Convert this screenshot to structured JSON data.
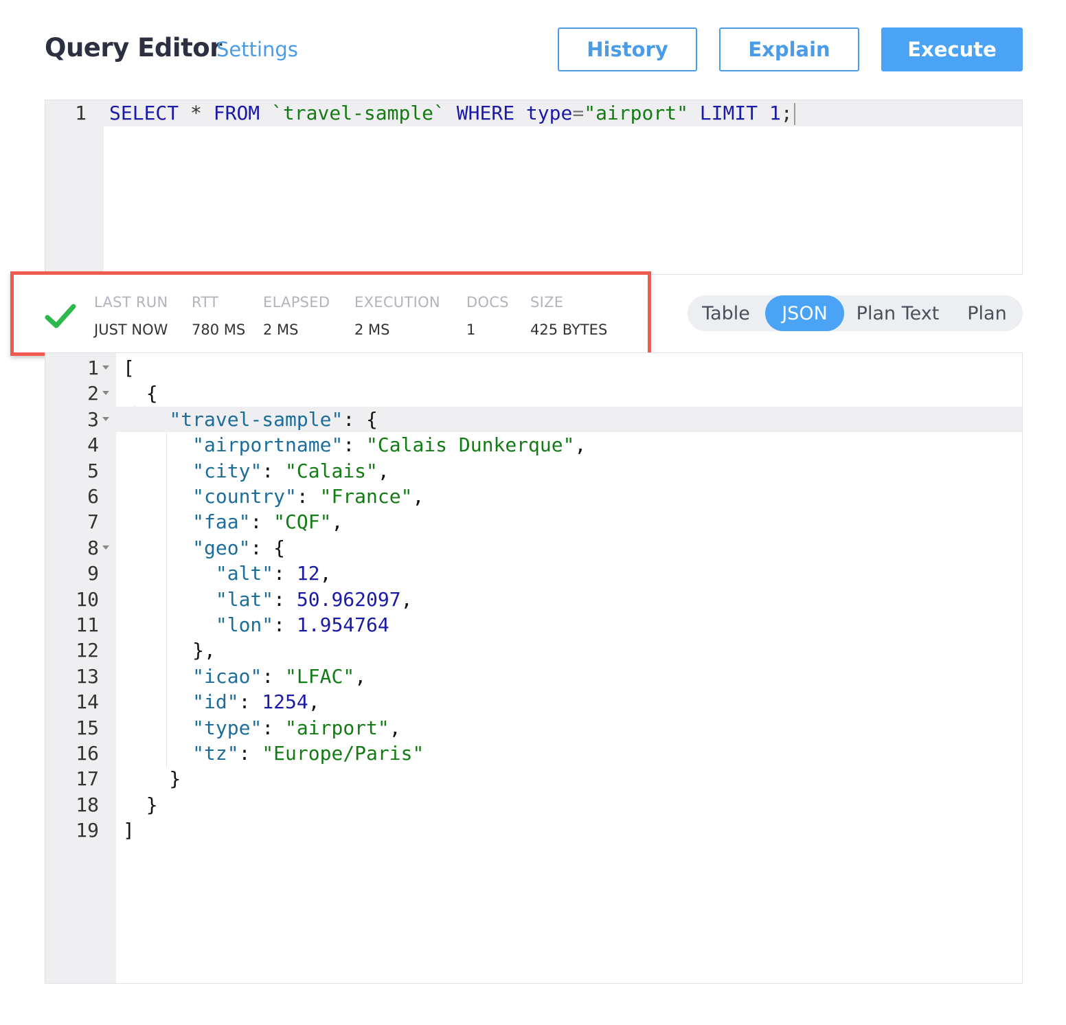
{
  "header": {
    "title": "Query Editor",
    "settings_label": "Settings",
    "buttons": {
      "history": "History",
      "explain": "Explain",
      "execute": "Execute"
    }
  },
  "query": {
    "line_number": "1",
    "tokens": {
      "select": "SELECT",
      "star": " * ",
      "from": "FROM",
      "sp1": " ",
      "bucket": "`travel-sample`",
      "sp2": " ",
      "where": "WHERE",
      "sp3": " ",
      "field": "type",
      "eq": "=",
      "value": "\"airport\"",
      "sp4": " ",
      "limit": "LIMIT",
      "sp5": " ",
      "limit_value": "1",
      "semi": ";"
    }
  },
  "status": {
    "items": [
      {
        "label": "LAST RUN",
        "value": "JUST NOW"
      },
      {
        "label": "RTT",
        "value": "780 MS"
      },
      {
        "label": "ELAPSED",
        "value": "2 MS"
      },
      {
        "label": "EXECUTION",
        "value": "2 MS"
      },
      {
        "label": "DOCS",
        "value": "1"
      },
      {
        "label": "SIZE",
        "value": "425 BYTES"
      }
    ],
    "success_color": "#2db84d"
  },
  "view_tabs": {
    "table": "Table",
    "json": "JSON",
    "plan_text": "Plan Text",
    "plan": "Plan",
    "active": "JSON"
  },
  "result": {
    "lines": [
      {
        "n": "1",
        "fold": true,
        "tokens": [
          {
            "t": "[",
            "c": "p"
          }
        ]
      },
      {
        "n": "2",
        "fold": true,
        "tokens": [
          {
            "t": "  {",
            "c": "p"
          }
        ]
      },
      {
        "n": "3",
        "fold": true,
        "active": true,
        "tokens": [
          {
            "t": "    ",
            "c": "p"
          },
          {
            "t": "\"travel-sample\"",
            "c": "k"
          },
          {
            "t": ": {",
            "c": "p"
          }
        ]
      },
      {
        "n": "4",
        "tokens": [
          {
            "t": "      ",
            "c": "p"
          },
          {
            "t": "\"airportname\"",
            "c": "k"
          },
          {
            "t": ": ",
            "c": "p"
          },
          {
            "t": "\"Calais Dunkerque\"",
            "c": "s"
          },
          {
            "t": ",",
            "c": "p"
          }
        ]
      },
      {
        "n": "5",
        "tokens": [
          {
            "t": "      ",
            "c": "p"
          },
          {
            "t": "\"city\"",
            "c": "k"
          },
          {
            "t": ": ",
            "c": "p"
          },
          {
            "t": "\"Calais\"",
            "c": "s"
          },
          {
            "t": ",",
            "c": "p"
          }
        ]
      },
      {
        "n": "6",
        "tokens": [
          {
            "t": "      ",
            "c": "p"
          },
          {
            "t": "\"country\"",
            "c": "k"
          },
          {
            "t": ": ",
            "c": "p"
          },
          {
            "t": "\"France\"",
            "c": "s"
          },
          {
            "t": ",",
            "c": "p"
          }
        ]
      },
      {
        "n": "7",
        "tokens": [
          {
            "t": "      ",
            "c": "p"
          },
          {
            "t": "\"faa\"",
            "c": "k"
          },
          {
            "t": ": ",
            "c": "p"
          },
          {
            "t": "\"CQF\"",
            "c": "s"
          },
          {
            "t": ",",
            "c": "p"
          }
        ]
      },
      {
        "n": "8",
        "fold": true,
        "tokens": [
          {
            "t": "      ",
            "c": "p"
          },
          {
            "t": "\"geo\"",
            "c": "k"
          },
          {
            "t": ": {",
            "c": "p"
          }
        ]
      },
      {
        "n": "9",
        "tokens": [
          {
            "t": "        ",
            "c": "p"
          },
          {
            "t": "\"alt\"",
            "c": "k"
          },
          {
            "t": ": ",
            "c": "p"
          },
          {
            "t": "12",
            "c": "n"
          },
          {
            "t": ",",
            "c": "p"
          }
        ]
      },
      {
        "n": "10",
        "tokens": [
          {
            "t": "        ",
            "c": "p"
          },
          {
            "t": "\"lat\"",
            "c": "k"
          },
          {
            "t": ": ",
            "c": "p"
          },
          {
            "t": "50.962097",
            "c": "n"
          },
          {
            "t": ",",
            "c": "p"
          }
        ]
      },
      {
        "n": "11",
        "tokens": [
          {
            "t": "        ",
            "c": "p"
          },
          {
            "t": "\"lon\"",
            "c": "k"
          },
          {
            "t": ": ",
            "c": "p"
          },
          {
            "t": "1.954764",
            "c": "n"
          }
        ]
      },
      {
        "n": "12",
        "tokens": [
          {
            "t": "      },",
            "c": "p"
          }
        ]
      },
      {
        "n": "13",
        "tokens": [
          {
            "t": "      ",
            "c": "p"
          },
          {
            "t": "\"icao\"",
            "c": "k"
          },
          {
            "t": ": ",
            "c": "p"
          },
          {
            "t": "\"LFAC\"",
            "c": "s"
          },
          {
            "t": ",",
            "c": "p"
          }
        ]
      },
      {
        "n": "14",
        "tokens": [
          {
            "t": "      ",
            "c": "p"
          },
          {
            "t": "\"id\"",
            "c": "k"
          },
          {
            "t": ": ",
            "c": "p"
          },
          {
            "t": "1254",
            "c": "n"
          },
          {
            "t": ",",
            "c": "p"
          }
        ]
      },
      {
        "n": "15",
        "tokens": [
          {
            "t": "      ",
            "c": "p"
          },
          {
            "t": "\"type\"",
            "c": "k"
          },
          {
            "t": ": ",
            "c": "p"
          },
          {
            "t": "\"airport\"",
            "c": "s"
          },
          {
            "t": ",",
            "c": "p"
          }
        ]
      },
      {
        "n": "16",
        "tokens": [
          {
            "t": "      ",
            "c": "p"
          },
          {
            "t": "\"tz\"",
            "c": "k"
          },
          {
            "t": ": ",
            "c": "p"
          },
          {
            "t": "\"Europe/Paris\"",
            "c": "s"
          }
        ]
      },
      {
        "n": "17",
        "tokens": [
          {
            "t": "    }",
            "c": "p"
          }
        ]
      },
      {
        "n": "18",
        "tokens": [
          {
            "t": "  }",
            "c": "p"
          }
        ]
      },
      {
        "n": "19",
        "tokens": [
          {
            "t": "]",
            "c": "p"
          }
        ]
      }
    ]
  },
  "colors": {
    "accent": "#4aa3f5",
    "highlight_border": "#f05a4f",
    "key": "#1d6d9a",
    "string": "#137b13",
    "number": "#1a1aa6",
    "keyword": "#1a1aa6"
  },
  "icons": {
    "status": "checkmark-icon",
    "fold": "fold-arrow-icon"
  }
}
